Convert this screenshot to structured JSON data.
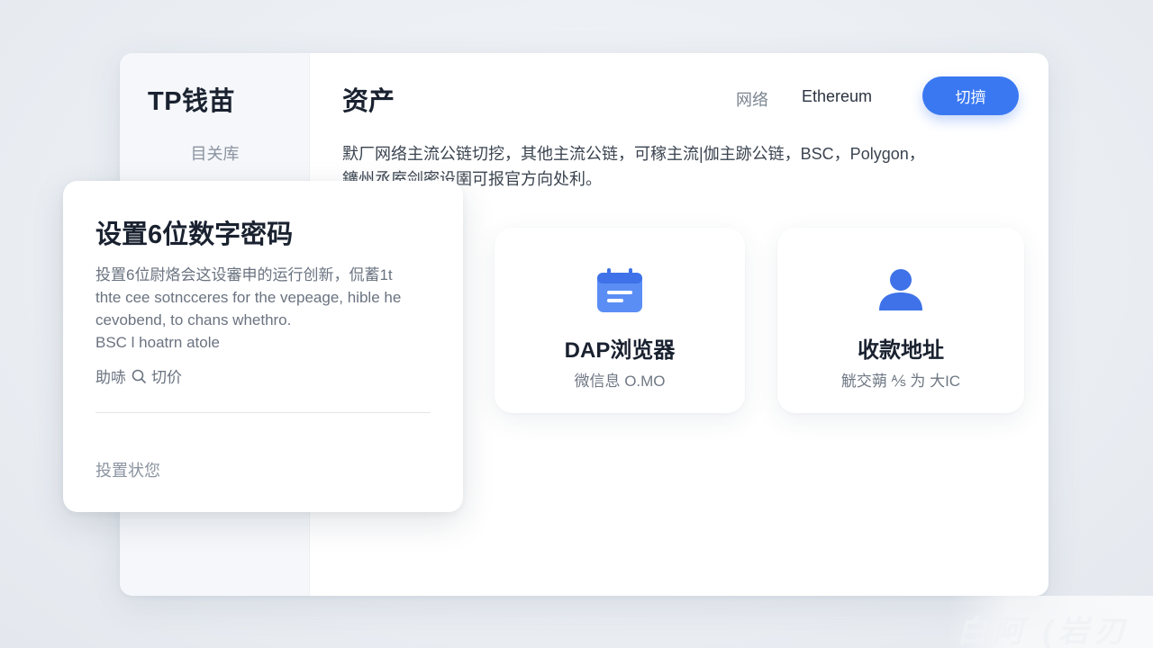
{
  "sidebar": {
    "brand": "TP钱苗",
    "items": [
      {
        "label": "目关库"
      }
    ]
  },
  "header": {
    "title": "资产",
    "network_label": "网络",
    "network_value": "Ethereum",
    "switch_label": "切擠"
  },
  "main": {
    "description_lines": [
      "默厂网络主流公链切挖，其他主流公链，可稼主流|伽主跡公链，BSC，Polygon，",
      "鑛州丞庢剑密设圉可报官方向处利。"
    ],
    "cards": [
      {
        "title": "DAP浏览器",
        "subtitle": "微信息 O.MO",
        "icon": "calendar-icon"
      },
      {
        "title": "收款地址",
        "subtitle": "觥交蒴 ⅍ 为 大IC",
        "icon": "user-icon"
      }
    ]
  },
  "dialog": {
    "title": "设置6位数字密码",
    "body_lines": [
      "投置6位尉烙会这设審申的运行创新，侃蓄1t",
      "thte cee sotncceres for the vepeage, hible he",
      "cevobend, to chans whethro.",
      "BSC l hoatrn atole"
    ],
    "help_prefix": "助哧",
    "help_suffix": "切价",
    "footer": "投置状您"
  },
  "watermark": "白阿 (岩刃",
  "colors": {
    "accent": "#3a78f2",
    "sidebar_bg": "#f5f7fa",
    "background": "#eceff3"
  }
}
